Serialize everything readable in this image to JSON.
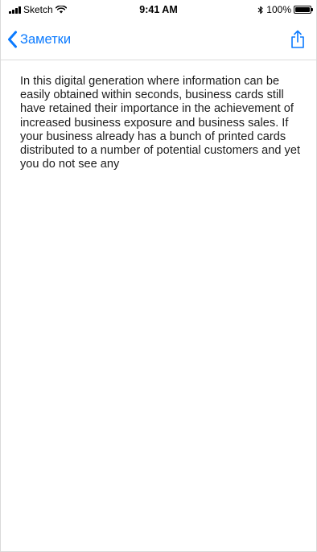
{
  "status_bar": {
    "carrier": "Sketch",
    "time": "9:41 AM",
    "battery_percent": "100%",
    "battery_level": 1.0
  },
  "nav": {
    "back_label": "Заметки",
    "accent_color": "#0a7aff"
  },
  "note": {
    "text": "In this digital generation where information can be easily obtained within seconds, business cards still have retained their importance in the achievement of increased business exposure and business sales. If your business already has a bunch of printed cards distributed to a number of potential customers and yet you do not see any"
  },
  "icons": {
    "signal": "cellular-signal-icon",
    "wifi": "wifi-icon",
    "bluetooth": "bluetooth-icon",
    "battery": "battery-icon",
    "back": "chevron-left-icon",
    "share": "share-icon"
  }
}
